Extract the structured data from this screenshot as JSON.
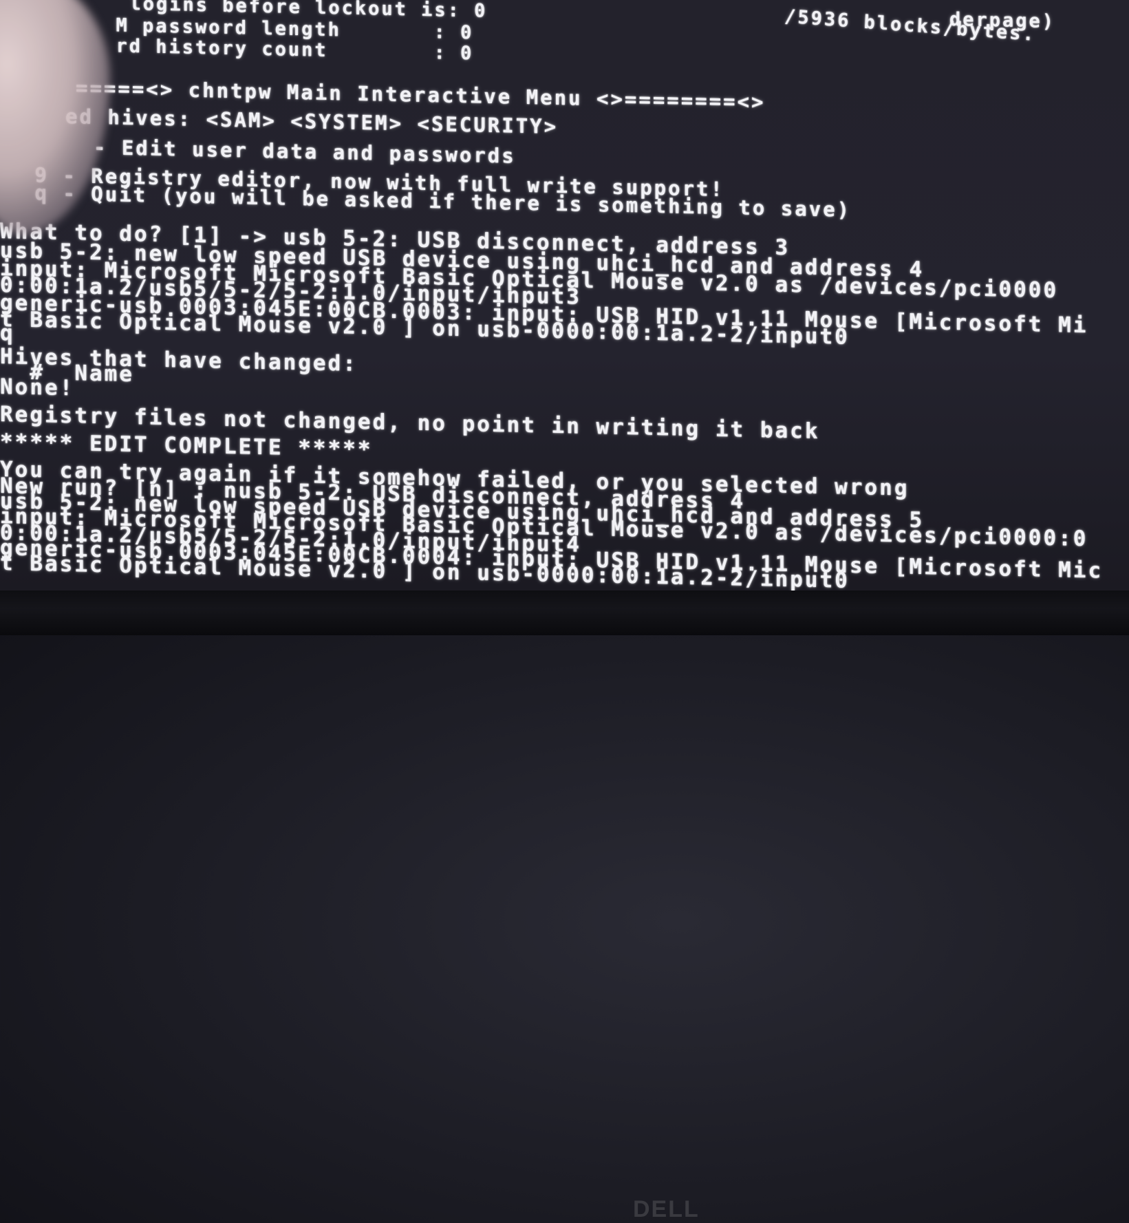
{
  "terminal": {
    "lines": [
      "  logins before lockout is: 0",
      "  M password length       : 0",
      "  rd history count        : 0",
      "=====<> chntpw Main Interactive Menu <>========<>",
      "ed hives: <SAM> <SYSTEM> <SECURITY>",
      "  - Edit user data and passwords",
      " 9 - Registry editor, now with full write support!",
      " q - Quit (you will be asked if there is something to save)",
      "What to do? [1] -> usb 5-2: USB disconnect, address 3",
      "usb 5-2: new low speed USB device using uhci_hcd and address 4",
      "input: Microsoft Microsoft Basic Optical Mouse v2.0 as /devices/pci0000",
      "0:00:1a.2/usb5/5-2/5-2:1.0/input/input3",
      "generic-usb 0003:045E:00CB.0003: input: USB HID v1.11 Mouse [Microsoft Mi",
      "t Basic Optical Mouse v2.0 ] on usb-0000:00:1a.2-2/input0",
      "q",
      "Hives that have changed:",
      "  #  Name",
      "None!",
      "Registry files not changed, no point in writing it back",
      "***** EDIT COMPLETE *****",
      "You can try again if it somehow failed, or you selected wrong",
      "New run? [n] : nusb 5-2: USB disconnect, address 4",
      "usb 5-2: new low speed USB device using uhci_hcd and address 5",
      "input: Microsoft Microsoft Basic Optical Mouse v2.0 as /devices/pci0000:0",
      "0:00:1a.2/usb5/5-2/5-2:1.0/input/input4",
      "generic-usb 0003:045E:00CB.0004: input: USB HID v1.11 Mouse [Microsoft Mic",
      "t Basic Optical Mouse v2.0 ] on usb-0000:00:1a.2-2/input0"
    ],
    "top_right_lines": [
      "/5936 blocks/bytes.",
      "derpage)"
    ]
  },
  "monitor": {
    "brand": "DELL"
  },
  "colors": {
    "screen_bg": "#23222c",
    "text": "#f2f2f6",
    "bezel": "#0e0e12"
  }
}
